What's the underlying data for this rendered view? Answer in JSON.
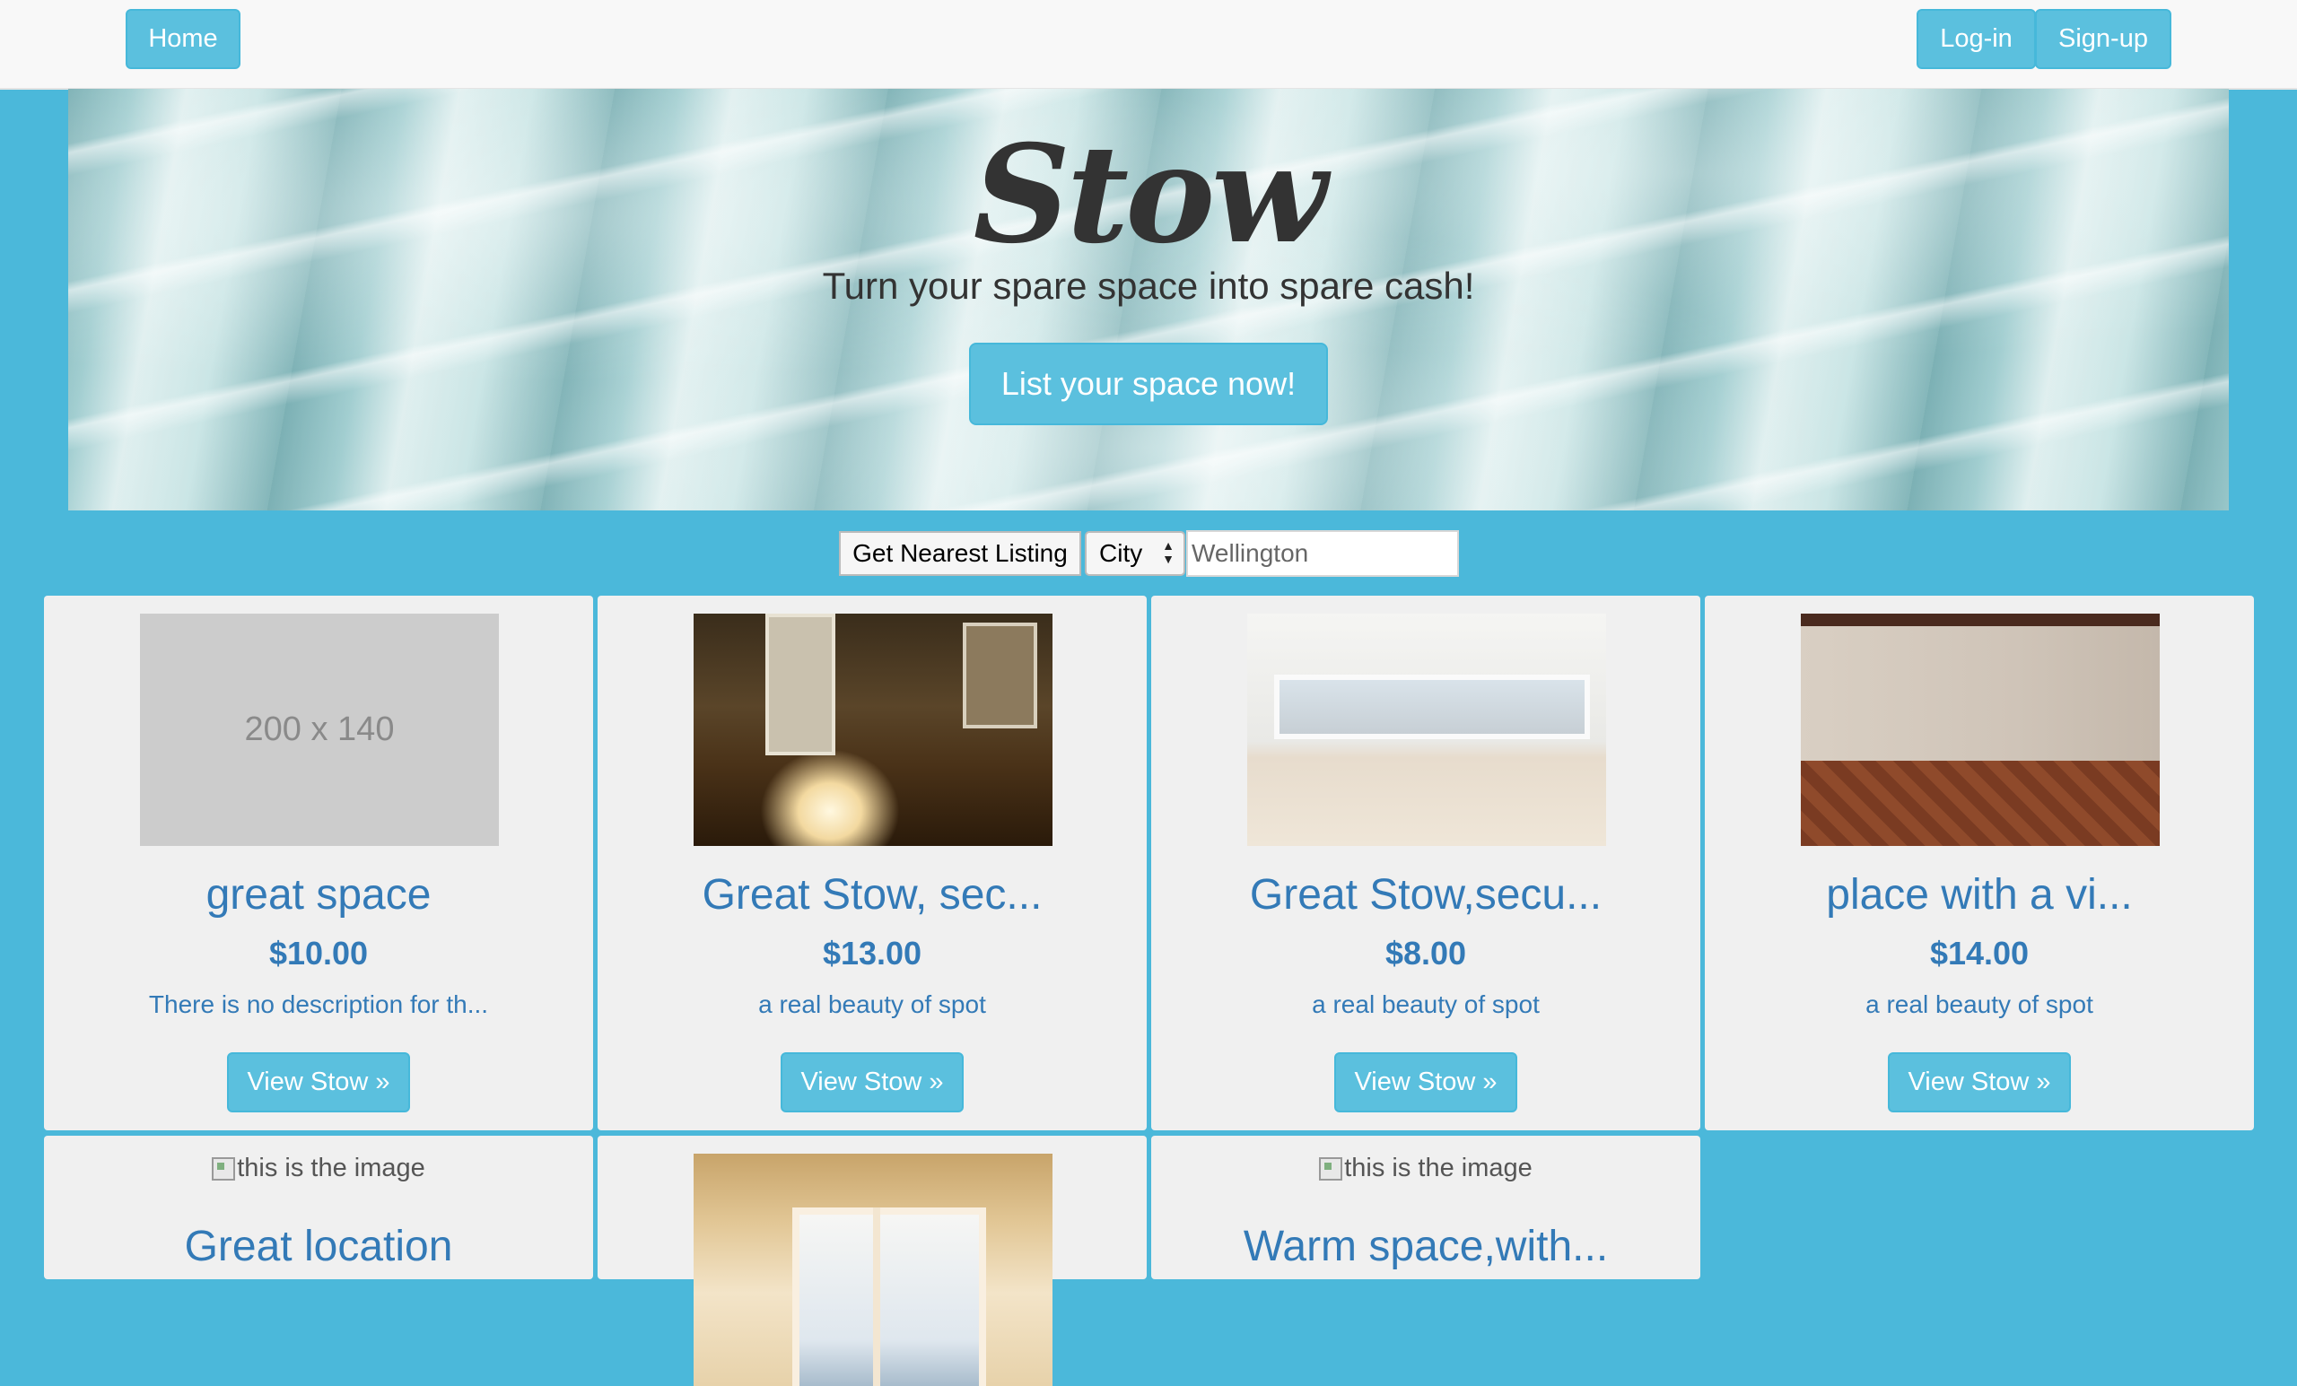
{
  "nav": {
    "home_label": "Home",
    "login_label": "Log-in",
    "signup_label": "Sign-up"
  },
  "hero": {
    "title": "Stow",
    "subtitle": "Turn your spare space into spare cash!",
    "cta_label": "List your space now!"
  },
  "search": {
    "nearest_label": "Get Nearest Listing",
    "select_value": "City",
    "input_value": "Wellington"
  },
  "listings": [
    {
      "title": "great space",
      "price": "$10.00",
      "description": "There is no description for th...",
      "button": "View Stow »",
      "thumb_text": "200 x 140"
    },
    {
      "title": "Great Stow, sec...",
      "price": "$13.00",
      "description": "a real beauty of spot",
      "button": "View Stow »"
    },
    {
      "title": "Great Stow,secu...",
      "price": "$8.00",
      "description": "a real beauty of spot",
      "button": "View Stow »"
    },
    {
      "title": "place with a vi...",
      "price": "$14.00",
      "description": "a real beauty of spot",
      "button": "View Stow »"
    },
    {
      "title": "Great location",
      "image_alt": "this is the image"
    },
    {
      "title": ""
    },
    {
      "title": "Warm space,with...",
      "image_alt": "this is the image"
    }
  ],
  "colors": {
    "page_bg": "#4bb8da",
    "button": "#5bc0de",
    "link": "#337ab7",
    "card_bg": "#f0f0f0"
  }
}
